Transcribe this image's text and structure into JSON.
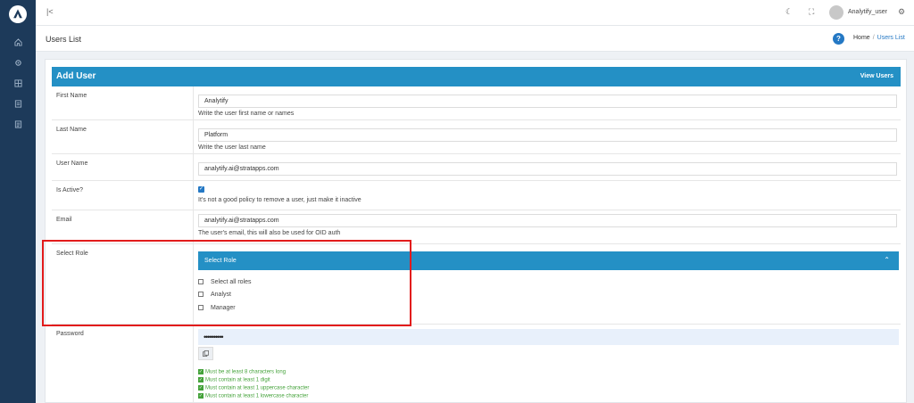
{
  "topbar": {
    "collapse_icon": "collapse-sidebar-icon",
    "theme_icon": "moon-icon",
    "fullscreen_icon": "fullscreen-icon",
    "username": "Analytify_user",
    "settings_icon": "gear-icon"
  },
  "sidebar": {
    "items": [
      {
        "icon": "home-icon"
      },
      {
        "icon": "settings-icon"
      },
      {
        "icon": "grid-icon"
      },
      {
        "icon": "document-icon"
      },
      {
        "icon": "list-icon"
      }
    ]
  },
  "subheader": {
    "title": "Users List",
    "breadcrumb": {
      "home": "Home",
      "separator": "/",
      "current": "Users List"
    }
  },
  "form": {
    "title": "Add User",
    "view_users": "View Users",
    "first_name": {
      "label": "First Name",
      "value": "Analytify",
      "help": "Write the user first name or names"
    },
    "last_name": {
      "label": "Last Name",
      "value": "Platform",
      "help": "Write the user last name"
    },
    "user_name": {
      "label": "User Name",
      "value": "analytify.ai@stratapps.com"
    },
    "is_active": {
      "label": "Is Active?",
      "checked": true,
      "help": "It's not a good policy to remove a user, just make it inactive"
    },
    "email": {
      "label": "Email",
      "value": "analytify.ai@stratapps.com",
      "help": "The user's email, this will also be used for OID auth"
    },
    "select_role": {
      "label": "Select Role",
      "panel_title": "Select Role",
      "options": [
        "Select all roles",
        "Analyst",
        "Manager"
      ]
    },
    "password": {
      "label": "Password",
      "masked": "••••••••••",
      "rules": [
        "Must be at least 8 characters long",
        "Must contain at least 1 digit",
        "Must contain at least 1 uppercase character",
        "Must contain at least 1 lowercase character"
      ]
    }
  },
  "colors": {
    "sidebar": "#1d3a5a",
    "accent": "#2490c5",
    "link": "#2478c4",
    "success": "#44a23a",
    "highlight": "#e21b1b"
  }
}
